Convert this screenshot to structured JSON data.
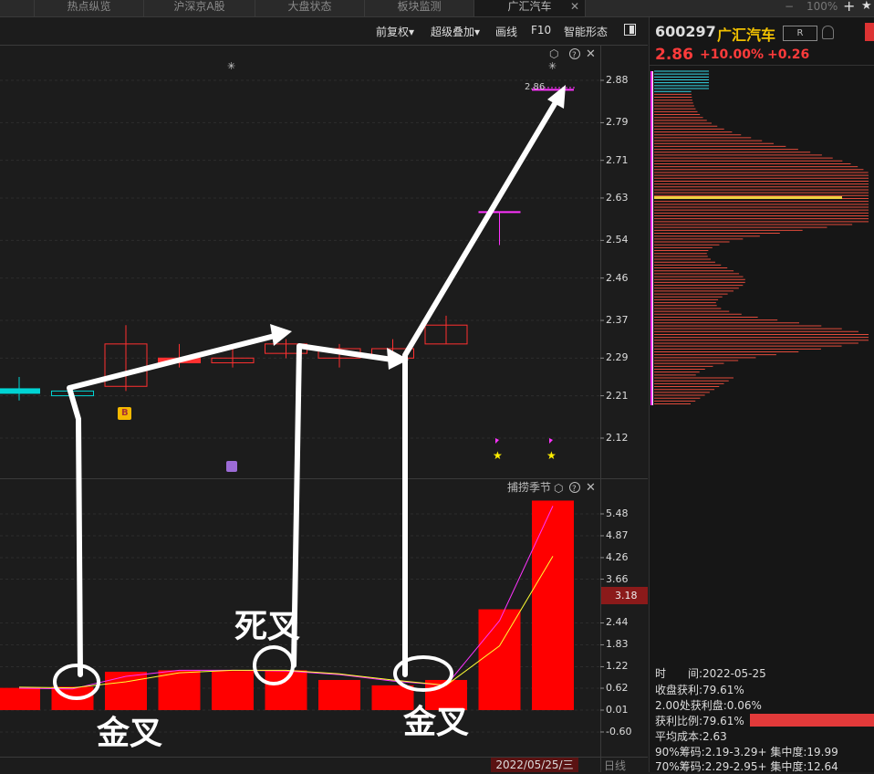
{
  "tabs": [
    {
      "label": "热点纵览",
      "active": false
    },
    {
      "label": "沪深京A股",
      "active": false
    },
    {
      "label": "大盘状态",
      "active": false
    },
    {
      "label": "板块监测",
      "active": false
    },
    {
      "label": "广汇汽车",
      "active": true
    }
  ],
  "tab_close": "✕",
  "window": {
    "zoom": "100%",
    "plus": "+",
    "star": "★",
    "minimize": "−"
  },
  "toolbar": {
    "fuquan": "前复权▾",
    "overlay": "超级叠加▾",
    "draw": "画线",
    "f10": "F10",
    "pattern": "智能形态",
    "layout_icon": "layout-icon"
  },
  "price_axis": [
    "2.88",
    "2.79",
    "2.71",
    "2.63",
    "2.54",
    "2.46",
    "2.37",
    "2.29",
    "2.21",
    "2.12"
  ],
  "price_marker": "2.86",
  "indicator": {
    "name": "捕捞季节",
    "axis": [
      "5.48",
      "4.87",
      "4.26",
      "3.66",
      "2.44",
      "1.83",
      "1.22",
      "0.62",
      "0.01",
      "-0.60"
    ],
    "current": "3.18"
  },
  "date_label": "2022/05/25/三",
  "period_label": "日线",
  "annotations": {
    "golden_cross": "金叉",
    "death_cross": "死叉"
  },
  "badge_b": "B",
  "stock": {
    "code": "600297",
    "name": "广汇汽车",
    "badge": "R",
    "price": "2.86",
    "change_pct": "+10.00%",
    "change": "+0.26"
  },
  "chip_info": {
    "time": "时　　间:2022-05-25",
    "profit_close": "收盘获利:79.61%",
    "profit_200": "2.00处获利盘:0.06%",
    "profit_ratio": "获利比例:79.61%",
    "avg_cost": "平均成本:2.63",
    "chip90": "90%筹码:2.19-3.29+ 集中度:19.99",
    "chip70": "70%筹码:2.29-2.95+ 集中度:12.64"
  },
  "colors": {
    "up": "#ff3030",
    "down": "#00d4d4",
    "yellow": "#ffff33",
    "magenta": "#ff33ff",
    "bg": "#1c1c1c"
  },
  "candles": [
    {
      "o": 2.22,
      "c": 2.22,
      "h": 2.25,
      "l": 2.2
    },
    {
      "o": 2.22,
      "c": 2.21,
      "h": 2.22,
      "l": 2.21
    },
    {
      "o": 2.23,
      "c": 2.32,
      "h": 2.36,
      "l": 2.22
    },
    {
      "o": 2.29,
      "c": 2.28,
      "h": 2.32,
      "l": 2.27
    },
    {
      "o": 2.28,
      "c": 2.29,
      "h": 2.31,
      "l": 2.27
    },
    {
      "o": 2.3,
      "c": 2.32,
      "h": 2.33,
      "l": 2.29
    },
    {
      "o": 2.31,
      "c": 2.29,
      "h": 2.32,
      "l": 2.27
    },
    {
      "o": 2.29,
      "c": 2.31,
      "h": 2.33,
      "l": 2.28
    },
    {
      "o": 2.32,
      "c": 2.36,
      "h": 2.38,
      "l": 2.32
    },
    {
      "o": 2.6,
      "c": 2.6,
      "h": 2.6,
      "l": 2.53
    },
    {
      "o": 2.86,
      "c": 2.86,
      "h": 2.86,
      "l": 2.86
    }
  ],
  "indicator_bars": [
    0.63,
    0.66,
    1.08,
    1.12,
    1.1,
    1.12,
    0.85,
    0.7,
    0.85,
    2.82,
    5.85
  ],
  "indicator_line1": [
    0.62,
    0.6,
    0.95,
    1.12,
    1.12,
    1.1,
    1.0,
    0.82,
    0.7,
    2.5,
    5.7
  ],
  "indicator_line2": [
    0.65,
    0.63,
    0.8,
    1.05,
    1.12,
    1.12,
    1.02,
    0.85,
    0.7,
    1.8,
    4.3
  ]
}
